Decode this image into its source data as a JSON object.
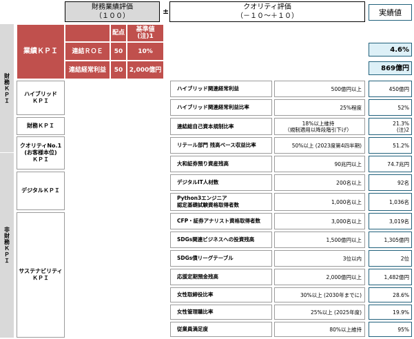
{
  "header": {
    "financial_eval_line1": "財務業績評価",
    "financial_eval_line2": "（１００）",
    "plusminus": "±",
    "quality_eval_line1": "クオリティ評価",
    "quality_eval_line2": "（－１０～＋１０）",
    "actual": "実績値"
  },
  "side_labels": {
    "financial": "財務ＫＰＩ",
    "non_financial": "非財務ＫＰＩ"
  },
  "performance_kpi": {
    "label": "業績ＫＰＩ",
    "col_weight": "配点",
    "col_base": "基準値\n(注)1",
    "rows": [
      {
        "name": "連結ＲＯＥ",
        "weight": "50",
        "base": "10%",
        "actual": "4.6%"
      },
      {
        "name": "連結経常利益",
        "weight": "50",
        "base": "2,000億円",
        "actual": "869億円"
      }
    ]
  },
  "categories": [
    {
      "id": "hybrid",
      "label": "ハイブリッド\nＫＰＩ"
    },
    {
      "id": "financial",
      "label": "財務ＫＰＩ"
    },
    {
      "id": "quality",
      "label": "クオリティNo.1\n(お客様本位)\nＫＰＩ"
    },
    {
      "id": "digital",
      "label": "デジタルＫＰＩ"
    },
    {
      "id": "sustain",
      "label": "サステナビリティ\nＫＰＩ"
    }
  ],
  "items": [
    {
      "name": "ハイブリッド関連経常利益",
      "target": "500億円以上",
      "target_sub": "",
      "actual": "450億円",
      "actual_sub": ""
    },
    {
      "name": "ハイブリッド関連経常利益比率",
      "target": "25%程度",
      "target_sub": "",
      "actual": "52%",
      "actual_sub": ""
    },
    {
      "name": "連結総自己資本規制比率",
      "target": "18%以上維持",
      "target_sub": "（規制適用以降段階引下げ）",
      "actual": "21.3%",
      "actual_sub": "(注)2"
    },
    {
      "name": "リテール部門 残高ベース収益比率",
      "target": "50%以上 (2023度第4四半期)",
      "target_sub": "",
      "actual": "51.2%",
      "actual_sub": ""
    },
    {
      "name": "大和証券預り資産残高",
      "target": "90兆円以上",
      "target_sub": "",
      "actual": "74.7兆円",
      "actual_sub": ""
    },
    {
      "name": "デジタルIT人材数",
      "target": "200名以上",
      "target_sub": "",
      "actual": "92名",
      "actual_sub": ""
    },
    {
      "name": "Python3エンジニア\n認定基礎試験資格取得者数",
      "target": "1,000名以上",
      "target_sub": "",
      "actual": "1,036名",
      "actual_sub": ""
    },
    {
      "name": "CFP・証券アナリスト資格取得者数",
      "target": "3,000名以上",
      "target_sub": "",
      "actual": "3,019名",
      "actual_sub": ""
    },
    {
      "name": "SDGs関連ビジネスへの投資残高",
      "target": "1,500億円以上",
      "target_sub": "",
      "actual": "1,305億円",
      "actual_sub": ""
    },
    {
      "name": "SDGs債リーグテーブル",
      "target": "3位以内",
      "target_sub": "",
      "actual": "2位",
      "actual_sub": ""
    },
    {
      "name": "応援定期預金残高",
      "target": "2,000億円以上",
      "target_sub": "",
      "actual": "1,482億円",
      "actual_sub": ""
    },
    {
      "name": "女性取締役比率",
      "target": "30%以上 (2030年までに)",
      "target_sub": "",
      "actual": "28.6%",
      "actual_sub": ""
    },
    {
      "name": "女性管理職比率",
      "target": "25%以上 (2025年度)",
      "target_sub": "",
      "actual": "19.9%",
      "actual_sub": ""
    },
    {
      "name": "従業員満足度",
      "target": "80%以上維持",
      "target_sub": "",
      "actual": "95%",
      "actual_sub": ""
    }
  ],
  "colors": {
    "kpi_red": "#c0504d",
    "actual_highlight": "#ddf0f7",
    "side_grey": "#d9d9d9"
  }
}
